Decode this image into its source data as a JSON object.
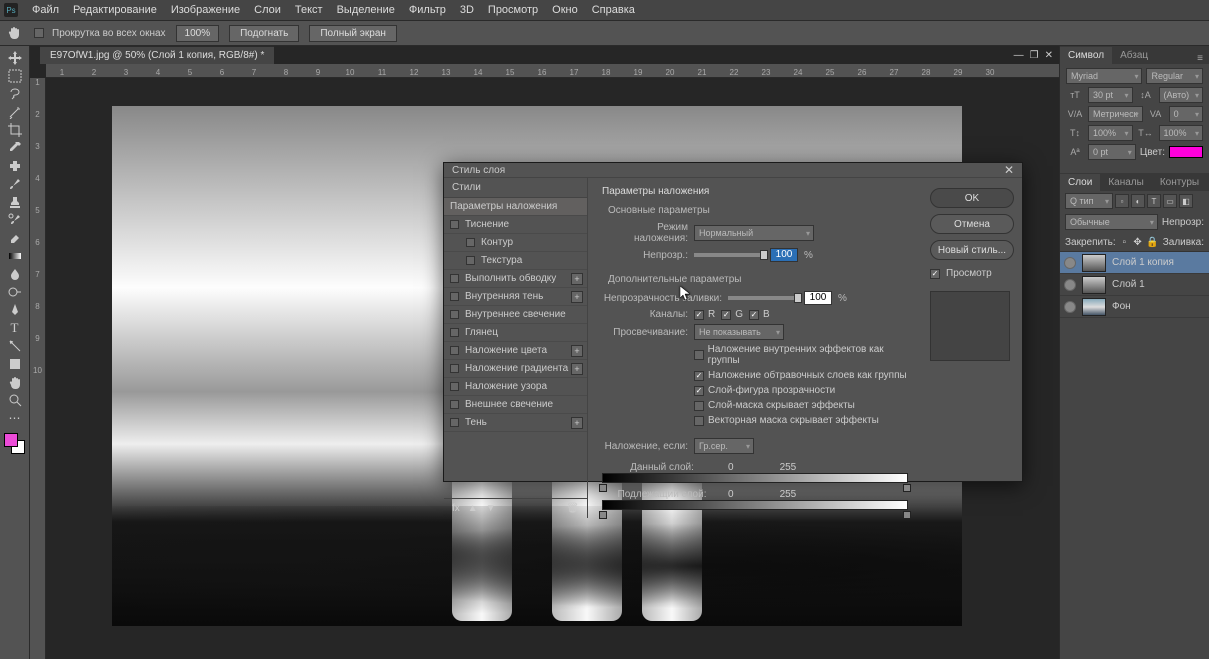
{
  "menu": {
    "items": [
      "Файл",
      "Редактирование",
      "Изображение",
      "Слои",
      "Текст",
      "Выделение",
      "Фильтр",
      "3D",
      "Просмотр",
      "Окно",
      "Справка"
    ]
  },
  "options_bar": {
    "scroll_label": "Прокрутка во всех окнах",
    "zoom": "100%",
    "fit": "Подогнать",
    "fullscreen": "Полный экран"
  },
  "doc": {
    "tab": "E97OfW1.jpg @ 50% (Слой 1 копия, RGB/8#) *"
  },
  "ruler_h": [
    "1",
    "2",
    "3",
    "4",
    "5",
    "6",
    "7",
    "8",
    "9",
    "10",
    "11",
    "12",
    "13",
    "14",
    "15",
    "16",
    "17",
    "18",
    "19",
    "20",
    "21",
    "22",
    "23",
    "24",
    "25",
    "26",
    "27",
    "28",
    "29",
    "30"
  ],
  "ruler_v": [
    "1",
    "2",
    "3",
    "4",
    "5",
    "6",
    "7",
    "8",
    "9",
    "10"
  ],
  "panels": {
    "char_tab1": "Символ",
    "char_tab2": "Абзац",
    "font": "Myriad",
    "style": "Regular",
    "size": "30 pt",
    "leading": "(Авто)",
    "tracking": "Метрическ",
    "va": "0",
    "vscale": "100%",
    "hscale": "100%",
    "baseline": "0 pt",
    "color_label": "Цвет:",
    "layers_tab1": "Слои",
    "layers_tab2": "Каналы",
    "layers_tab3": "Контуры",
    "blend_mode": "Обычные",
    "opacity_label": "Непрозр:",
    "lock_label": "Закрепить:",
    "fill_label": "Заливка:",
    "filter": "Q тип",
    "layer1": "Слой 1 копия",
    "layer2": "Слой 1",
    "layer3": "Фон"
  },
  "dialog": {
    "title": "Стиль слоя",
    "styles_header": "Стили",
    "list": [
      "Параметры наложения",
      "Тиснение",
      "Контур",
      "Текстура",
      "Выполнить обводку",
      "Внутренняя тень",
      "Внутреннее свечение",
      "Глянец",
      "Наложение цвета",
      "Наложение градиента",
      "Наложение узора",
      "Внешнее свечение",
      "Тень"
    ],
    "section1": "Параметры наложения",
    "section1_sub": "Основные параметры",
    "blend_mode_lbl": "Режим наложения:",
    "blend_mode": "Нормальный",
    "opacity_lbl": "Непрозр.:",
    "opacity": "100",
    "section2": "Дополнительные параметры",
    "fill_opacity_lbl": "Непрозрачность заливки:",
    "fill_opacity": "100",
    "channels_lbl": "Каналы:",
    "ch_r": "R",
    "ch_g": "G",
    "ch_b": "B",
    "knockout_lbl": "Просвечивание:",
    "knockout": "Не показывать",
    "adv1": "Наложение внутренних эффектов как группы",
    "adv2": "Наложение обтравочных слоев как группы",
    "adv3": "Слой-фигура прозрачности",
    "adv4": "Слой-маска скрывает эффекты",
    "adv5": "Векторная маска скрывает эффекты",
    "blendif_lbl": "Наложение, если:",
    "blendif": "Гр.сер.",
    "this_layer": "Данный слой:",
    "this_lo": "0",
    "this_hi": "255",
    "under_layer": "Подлежащий слой:",
    "under_lo": "0",
    "under_hi": "255",
    "ok": "OK",
    "cancel": "Отмена",
    "new_style": "Новый стиль...",
    "preview": "Просмотр"
  }
}
